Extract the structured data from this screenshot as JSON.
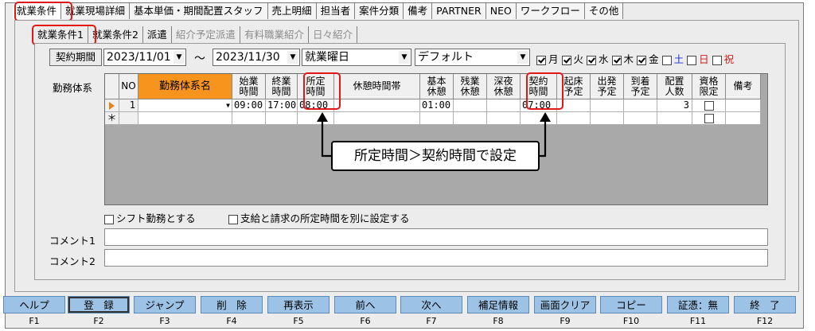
{
  "main_tabs": [
    "就業条件",
    "就業現場詳細",
    "基本単価・期間配置スタッフ",
    "売上明細",
    "担当者",
    "案件分類",
    "備考",
    "PARTNER",
    "NEO",
    "ワークフロー",
    "その他"
  ],
  "sub_tabs": [
    {
      "label": "就業条件1",
      "disabled": false
    },
    {
      "label": "就業条件2",
      "disabled": false
    },
    {
      "label": "派遣",
      "disabled": false
    },
    {
      "label": "紹介予定派遣",
      "disabled": true
    },
    {
      "label": "有料職業紹介",
      "disabled": true
    },
    {
      "label": "日々紹介",
      "disabled": true
    }
  ],
  "contract": {
    "button_label": "契約期間",
    "start_date": "2023/11/01",
    "tilde": "～",
    "end_date": "2023/11/30",
    "day_type": "就業曜日",
    "pattern": "デフォルト"
  },
  "weekdays": [
    {
      "label": "月",
      "checked": true,
      "color": "#000000"
    },
    {
      "label": "火",
      "checked": true,
      "color": "#000000"
    },
    {
      "label": "水",
      "checked": true,
      "color": "#000000"
    },
    {
      "label": "木",
      "checked": true,
      "color": "#000000"
    },
    {
      "label": "金",
      "checked": true,
      "color": "#000000"
    },
    {
      "label": "土",
      "checked": false,
      "color": "#1a2fd0"
    },
    {
      "label": "日",
      "checked": false,
      "color": "#d01a1a"
    },
    {
      "label": "祝",
      "checked": false,
      "color": "#d01a1a"
    }
  ],
  "work_system_label": "勤務体系",
  "grid": {
    "headers": [
      "NO",
      "勤務体系名",
      "始業\n時間",
      "終業\n時間",
      "所定\n時間",
      "休憩時間帯",
      "基本\n休憩",
      "残業\n休憩",
      "深夜\n休憩",
      "契約\n時間",
      "起床\n予定",
      "出発\n予定",
      "到着\n予定",
      "配置\n人数",
      "資格\n限定",
      "備考"
    ],
    "row1": {
      "no": "1",
      "name": "",
      "start": "09:00",
      "end": "17:00",
      "scheduled": "08:00",
      "break_band": "",
      "basic_break": "01:00",
      "ot_break": "",
      "night_break": "",
      "contract": "07:00",
      "wake": "",
      "depart": "",
      "arrive": "",
      "staff": "3",
      "qualified": false,
      "note": ""
    },
    "new_row_marker": "＊"
  },
  "callout": "所定時間＞契約時間で設定",
  "options": {
    "shift_label": "シフト勤務とする",
    "separate_label": "支給と請求の所定時間を別に設定する"
  },
  "comments": [
    "コメント1",
    "コメント2"
  ],
  "fkeys": [
    {
      "label": "ヘルプ",
      "key": "F1"
    },
    {
      "label": "登　録",
      "key": "F2"
    },
    {
      "label": "ジャンプ",
      "key": "F3"
    },
    {
      "label": "削　除",
      "key": "F4"
    },
    {
      "label": "再表示",
      "key": "F5"
    },
    {
      "label": "前へ",
      "key": "F6"
    },
    {
      "label": "次へ",
      "key": "F7"
    },
    {
      "label": "補足情報",
      "key": "F8"
    },
    {
      "label": "画面クリア",
      "key": "F9"
    },
    {
      "label": "コピー",
      "key": "F10"
    },
    {
      "label": "証憑：無",
      "key": "F11"
    },
    {
      "label": "終　了",
      "key": "F12"
    }
  ],
  "colors": {
    "highlight": "#e01818",
    "header_accent": "#f7941d",
    "fkey": "#9cc2e5",
    "grid_empty": "#a9a9a9"
  }
}
